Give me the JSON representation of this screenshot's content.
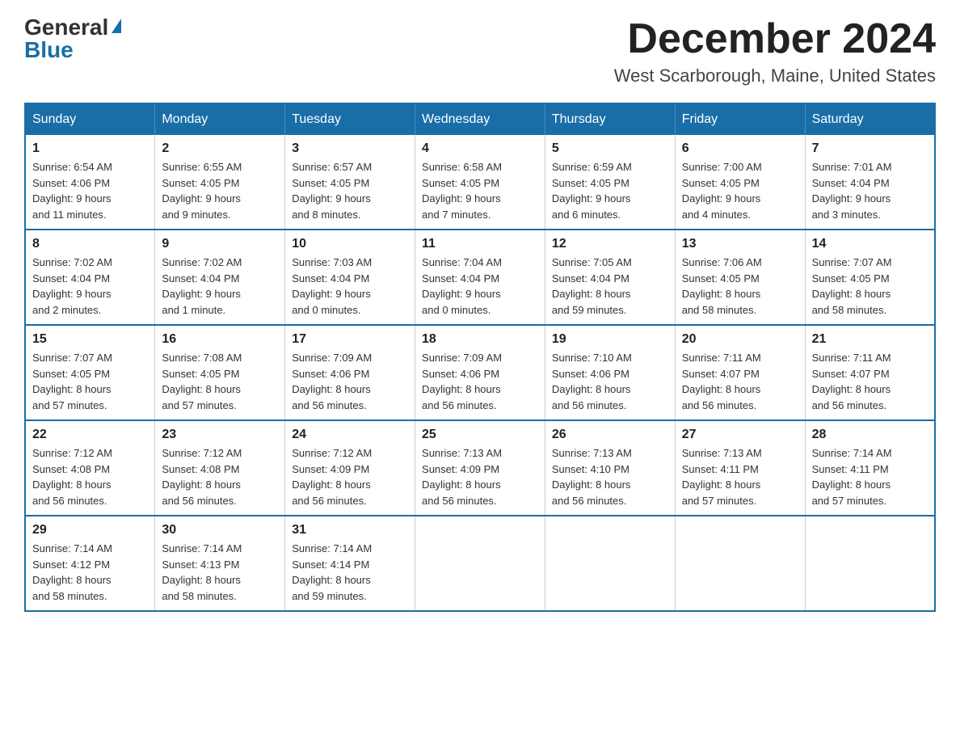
{
  "header": {
    "logo_general": "General",
    "logo_blue": "Blue",
    "title": "December 2024",
    "subtitle": "West Scarborough, Maine, United States"
  },
  "days_of_week": [
    "Sunday",
    "Monday",
    "Tuesday",
    "Wednesday",
    "Thursday",
    "Friday",
    "Saturday"
  ],
  "weeks": [
    [
      {
        "day": "1",
        "sunrise": "6:54 AM",
        "sunset": "4:06 PM",
        "daylight": "9 hours and 11 minutes."
      },
      {
        "day": "2",
        "sunrise": "6:55 AM",
        "sunset": "4:05 PM",
        "daylight": "9 hours and 9 minutes."
      },
      {
        "day": "3",
        "sunrise": "6:57 AM",
        "sunset": "4:05 PM",
        "daylight": "9 hours and 8 minutes."
      },
      {
        "day": "4",
        "sunrise": "6:58 AM",
        "sunset": "4:05 PM",
        "daylight": "9 hours and 7 minutes."
      },
      {
        "day": "5",
        "sunrise": "6:59 AM",
        "sunset": "4:05 PM",
        "daylight": "9 hours and 6 minutes."
      },
      {
        "day": "6",
        "sunrise": "7:00 AM",
        "sunset": "4:05 PM",
        "daylight": "9 hours and 4 minutes."
      },
      {
        "day": "7",
        "sunrise": "7:01 AM",
        "sunset": "4:04 PM",
        "daylight": "9 hours and 3 minutes."
      }
    ],
    [
      {
        "day": "8",
        "sunrise": "7:02 AM",
        "sunset": "4:04 PM",
        "daylight": "9 hours and 2 minutes."
      },
      {
        "day": "9",
        "sunrise": "7:02 AM",
        "sunset": "4:04 PM",
        "daylight": "9 hours and 1 minute."
      },
      {
        "day": "10",
        "sunrise": "7:03 AM",
        "sunset": "4:04 PM",
        "daylight": "9 hours and 0 minutes."
      },
      {
        "day": "11",
        "sunrise": "7:04 AM",
        "sunset": "4:04 PM",
        "daylight": "9 hours and 0 minutes."
      },
      {
        "day": "12",
        "sunrise": "7:05 AM",
        "sunset": "4:04 PM",
        "daylight": "8 hours and 59 minutes."
      },
      {
        "day": "13",
        "sunrise": "7:06 AM",
        "sunset": "4:05 PM",
        "daylight": "8 hours and 58 minutes."
      },
      {
        "day": "14",
        "sunrise": "7:07 AM",
        "sunset": "4:05 PM",
        "daylight": "8 hours and 58 minutes."
      }
    ],
    [
      {
        "day": "15",
        "sunrise": "7:07 AM",
        "sunset": "4:05 PM",
        "daylight": "8 hours and 57 minutes."
      },
      {
        "day": "16",
        "sunrise": "7:08 AM",
        "sunset": "4:05 PM",
        "daylight": "8 hours and 57 minutes."
      },
      {
        "day": "17",
        "sunrise": "7:09 AM",
        "sunset": "4:06 PM",
        "daylight": "8 hours and 56 minutes."
      },
      {
        "day": "18",
        "sunrise": "7:09 AM",
        "sunset": "4:06 PM",
        "daylight": "8 hours and 56 minutes."
      },
      {
        "day": "19",
        "sunrise": "7:10 AM",
        "sunset": "4:06 PM",
        "daylight": "8 hours and 56 minutes."
      },
      {
        "day": "20",
        "sunrise": "7:11 AM",
        "sunset": "4:07 PM",
        "daylight": "8 hours and 56 minutes."
      },
      {
        "day": "21",
        "sunrise": "7:11 AM",
        "sunset": "4:07 PM",
        "daylight": "8 hours and 56 minutes."
      }
    ],
    [
      {
        "day": "22",
        "sunrise": "7:12 AM",
        "sunset": "4:08 PM",
        "daylight": "8 hours and 56 minutes."
      },
      {
        "day": "23",
        "sunrise": "7:12 AM",
        "sunset": "4:08 PM",
        "daylight": "8 hours and 56 minutes."
      },
      {
        "day": "24",
        "sunrise": "7:12 AM",
        "sunset": "4:09 PM",
        "daylight": "8 hours and 56 minutes."
      },
      {
        "day": "25",
        "sunrise": "7:13 AM",
        "sunset": "4:09 PM",
        "daylight": "8 hours and 56 minutes."
      },
      {
        "day": "26",
        "sunrise": "7:13 AM",
        "sunset": "4:10 PM",
        "daylight": "8 hours and 56 minutes."
      },
      {
        "day": "27",
        "sunrise": "7:13 AM",
        "sunset": "4:11 PM",
        "daylight": "8 hours and 57 minutes."
      },
      {
        "day": "28",
        "sunrise": "7:14 AM",
        "sunset": "4:11 PM",
        "daylight": "8 hours and 57 minutes."
      }
    ],
    [
      {
        "day": "29",
        "sunrise": "7:14 AM",
        "sunset": "4:12 PM",
        "daylight": "8 hours and 58 minutes."
      },
      {
        "day": "30",
        "sunrise": "7:14 AM",
        "sunset": "4:13 PM",
        "daylight": "8 hours and 58 minutes."
      },
      {
        "day": "31",
        "sunrise": "7:14 AM",
        "sunset": "4:14 PM",
        "daylight": "8 hours and 59 minutes."
      },
      null,
      null,
      null,
      null
    ]
  ],
  "labels": {
    "sunrise": "Sunrise:",
    "sunset": "Sunset:",
    "daylight": "Daylight:"
  }
}
